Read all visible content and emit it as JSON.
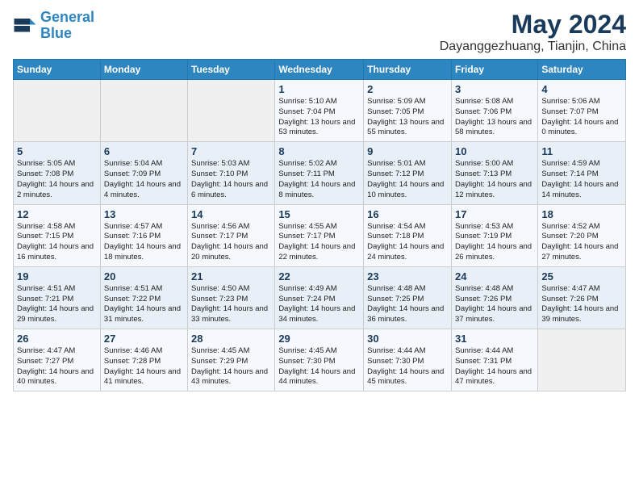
{
  "header": {
    "logo_line1": "General",
    "logo_line2": "Blue",
    "main_title": "May 2024",
    "subtitle": "Dayanggezhuang, Tianjin, China"
  },
  "weekdays": [
    "Sunday",
    "Monday",
    "Tuesday",
    "Wednesday",
    "Thursday",
    "Friday",
    "Saturday"
  ],
  "weeks": [
    [
      {
        "day": "",
        "info": ""
      },
      {
        "day": "",
        "info": ""
      },
      {
        "day": "",
        "info": ""
      },
      {
        "day": "1",
        "info": "Sunrise: 5:10 AM\nSunset: 7:04 PM\nDaylight: 13 hours and 53 minutes."
      },
      {
        "day": "2",
        "info": "Sunrise: 5:09 AM\nSunset: 7:05 PM\nDaylight: 13 hours and 55 minutes."
      },
      {
        "day": "3",
        "info": "Sunrise: 5:08 AM\nSunset: 7:06 PM\nDaylight: 13 hours and 58 minutes."
      },
      {
        "day": "4",
        "info": "Sunrise: 5:06 AM\nSunset: 7:07 PM\nDaylight: 14 hours and 0 minutes."
      }
    ],
    [
      {
        "day": "5",
        "info": "Sunrise: 5:05 AM\nSunset: 7:08 PM\nDaylight: 14 hours and 2 minutes."
      },
      {
        "day": "6",
        "info": "Sunrise: 5:04 AM\nSunset: 7:09 PM\nDaylight: 14 hours and 4 minutes."
      },
      {
        "day": "7",
        "info": "Sunrise: 5:03 AM\nSunset: 7:10 PM\nDaylight: 14 hours and 6 minutes."
      },
      {
        "day": "8",
        "info": "Sunrise: 5:02 AM\nSunset: 7:11 PM\nDaylight: 14 hours and 8 minutes."
      },
      {
        "day": "9",
        "info": "Sunrise: 5:01 AM\nSunset: 7:12 PM\nDaylight: 14 hours and 10 minutes."
      },
      {
        "day": "10",
        "info": "Sunrise: 5:00 AM\nSunset: 7:13 PM\nDaylight: 14 hours and 12 minutes."
      },
      {
        "day": "11",
        "info": "Sunrise: 4:59 AM\nSunset: 7:14 PM\nDaylight: 14 hours and 14 minutes."
      }
    ],
    [
      {
        "day": "12",
        "info": "Sunrise: 4:58 AM\nSunset: 7:15 PM\nDaylight: 14 hours and 16 minutes."
      },
      {
        "day": "13",
        "info": "Sunrise: 4:57 AM\nSunset: 7:16 PM\nDaylight: 14 hours and 18 minutes."
      },
      {
        "day": "14",
        "info": "Sunrise: 4:56 AM\nSunset: 7:17 PM\nDaylight: 14 hours and 20 minutes."
      },
      {
        "day": "15",
        "info": "Sunrise: 4:55 AM\nSunset: 7:17 PM\nDaylight: 14 hours and 22 minutes."
      },
      {
        "day": "16",
        "info": "Sunrise: 4:54 AM\nSunset: 7:18 PM\nDaylight: 14 hours and 24 minutes."
      },
      {
        "day": "17",
        "info": "Sunrise: 4:53 AM\nSunset: 7:19 PM\nDaylight: 14 hours and 26 minutes."
      },
      {
        "day": "18",
        "info": "Sunrise: 4:52 AM\nSunset: 7:20 PM\nDaylight: 14 hours and 27 minutes."
      }
    ],
    [
      {
        "day": "19",
        "info": "Sunrise: 4:51 AM\nSunset: 7:21 PM\nDaylight: 14 hours and 29 minutes."
      },
      {
        "day": "20",
        "info": "Sunrise: 4:51 AM\nSunset: 7:22 PM\nDaylight: 14 hours and 31 minutes."
      },
      {
        "day": "21",
        "info": "Sunrise: 4:50 AM\nSunset: 7:23 PM\nDaylight: 14 hours and 33 minutes."
      },
      {
        "day": "22",
        "info": "Sunrise: 4:49 AM\nSunset: 7:24 PM\nDaylight: 14 hours and 34 minutes."
      },
      {
        "day": "23",
        "info": "Sunrise: 4:48 AM\nSunset: 7:25 PM\nDaylight: 14 hours and 36 minutes."
      },
      {
        "day": "24",
        "info": "Sunrise: 4:48 AM\nSunset: 7:26 PM\nDaylight: 14 hours and 37 minutes."
      },
      {
        "day": "25",
        "info": "Sunrise: 4:47 AM\nSunset: 7:26 PM\nDaylight: 14 hours and 39 minutes."
      }
    ],
    [
      {
        "day": "26",
        "info": "Sunrise: 4:47 AM\nSunset: 7:27 PM\nDaylight: 14 hours and 40 minutes."
      },
      {
        "day": "27",
        "info": "Sunrise: 4:46 AM\nSunset: 7:28 PM\nDaylight: 14 hours and 41 minutes."
      },
      {
        "day": "28",
        "info": "Sunrise: 4:45 AM\nSunset: 7:29 PM\nDaylight: 14 hours and 43 minutes."
      },
      {
        "day": "29",
        "info": "Sunrise: 4:45 AM\nSunset: 7:30 PM\nDaylight: 14 hours and 44 minutes."
      },
      {
        "day": "30",
        "info": "Sunrise: 4:44 AM\nSunset: 7:30 PM\nDaylight: 14 hours and 45 minutes."
      },
      {
        "day": "31",
        "info": "Sunrise: 4:44 AM\nSunset: 7:31 PM\nDaylight: 14 hours and 47 minutes."
      },
      {
        "day": "",
        "info": ""
      }
    ]
  ]
}
